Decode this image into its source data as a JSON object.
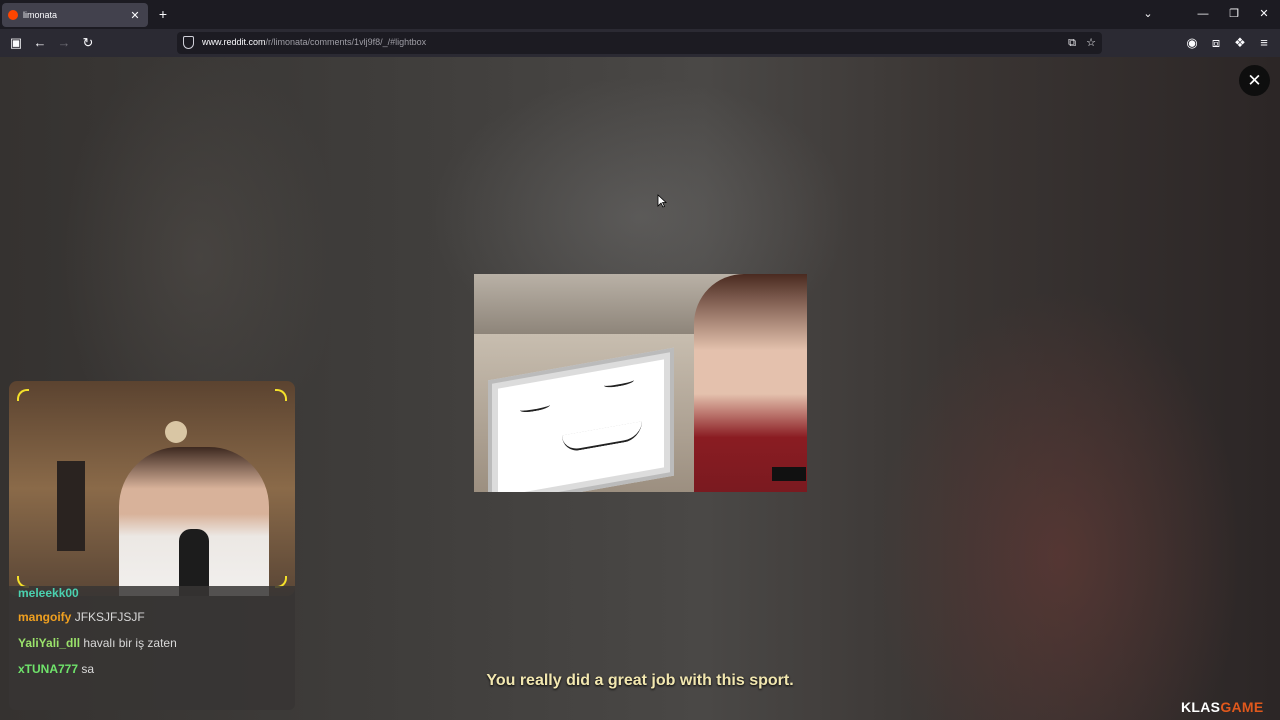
{
  "browser": {
    "tab": {
      "title": "limonata"
    },
    "url": {
      "host": "www.reddit.com",
      "path": "/r/limonata/comments/1vlj9f8/_/#lightbox"
    }
  },
  "icons": {
    "tab_favicon": "reddit-icon",
    "tab_close": "close-icon",
    "new_tab": "plus-icon",
    "list_all_tabs": "chevron-down-icon",
    "minimize": "minimize-icon",
    "restore": "restore-icon",
    "window_close": "close-icon",
    "sidebar": "sidebar-icon",
    "back": "back-arrow-icon",
    "forward": "forward-arrow-icon",
    "reload": "reload-icon",
    "site_info": "shield-icon",
    "reader": "translate-icon",
    "bookmark": "star-icon",
    "account": "account-icon",
    "extensions": "puzzle-icon",
    "pocket": "flame-icon",
    "menu": "hamburger-icon",
    "lightbox_close": "close-icon"
  },
  "glyphs": {
    "tab_close": "✕",
    "new_tab": "+",
    "chevron": "⌄",
    "minimize": "—",
    "restore": "❐",
    "window_close": "✕",
    "sidebar": "▣",
    "back": "←",
    "forward": "→",
    "reload": "↻",
    "reader": "⧉",
    "bookmark": "☆",
    "account": "◉",
    "extensions": "⧈",
    "pocket": "❖",
    "menu": "≡",
    "lightbox_close": "✕"
  },
  "stream_overlay": {
    "chat": [
      {
        "user": "meleekk00",
        "message": "",
        "color": "#4ad1b0"
      },
      {
        "user": "mangoify",
        "message": "JFKSJFJSJF",
        "color": "#f0a020"
      },
      {
        "user": "YaliYali_dll",
        "message": "havalı bir iş zaten",
        "color": "#9be36b"
      },
      {
        "user": "xTUNA777",
        "message": "sa",
        "color": "#6fe36b"
      }
    ],
    "subtitle": "You really did a great job with this sport.",
    "watermark": {
      "part1": "KLAS",
      "part2": "GAME"
    }
  },
  "colors": {
    "accent_reddit": "#ff4500",
    "watermark_orange": "#e0581c",
    "subtitle": "#f2e7b0"
  }
}
